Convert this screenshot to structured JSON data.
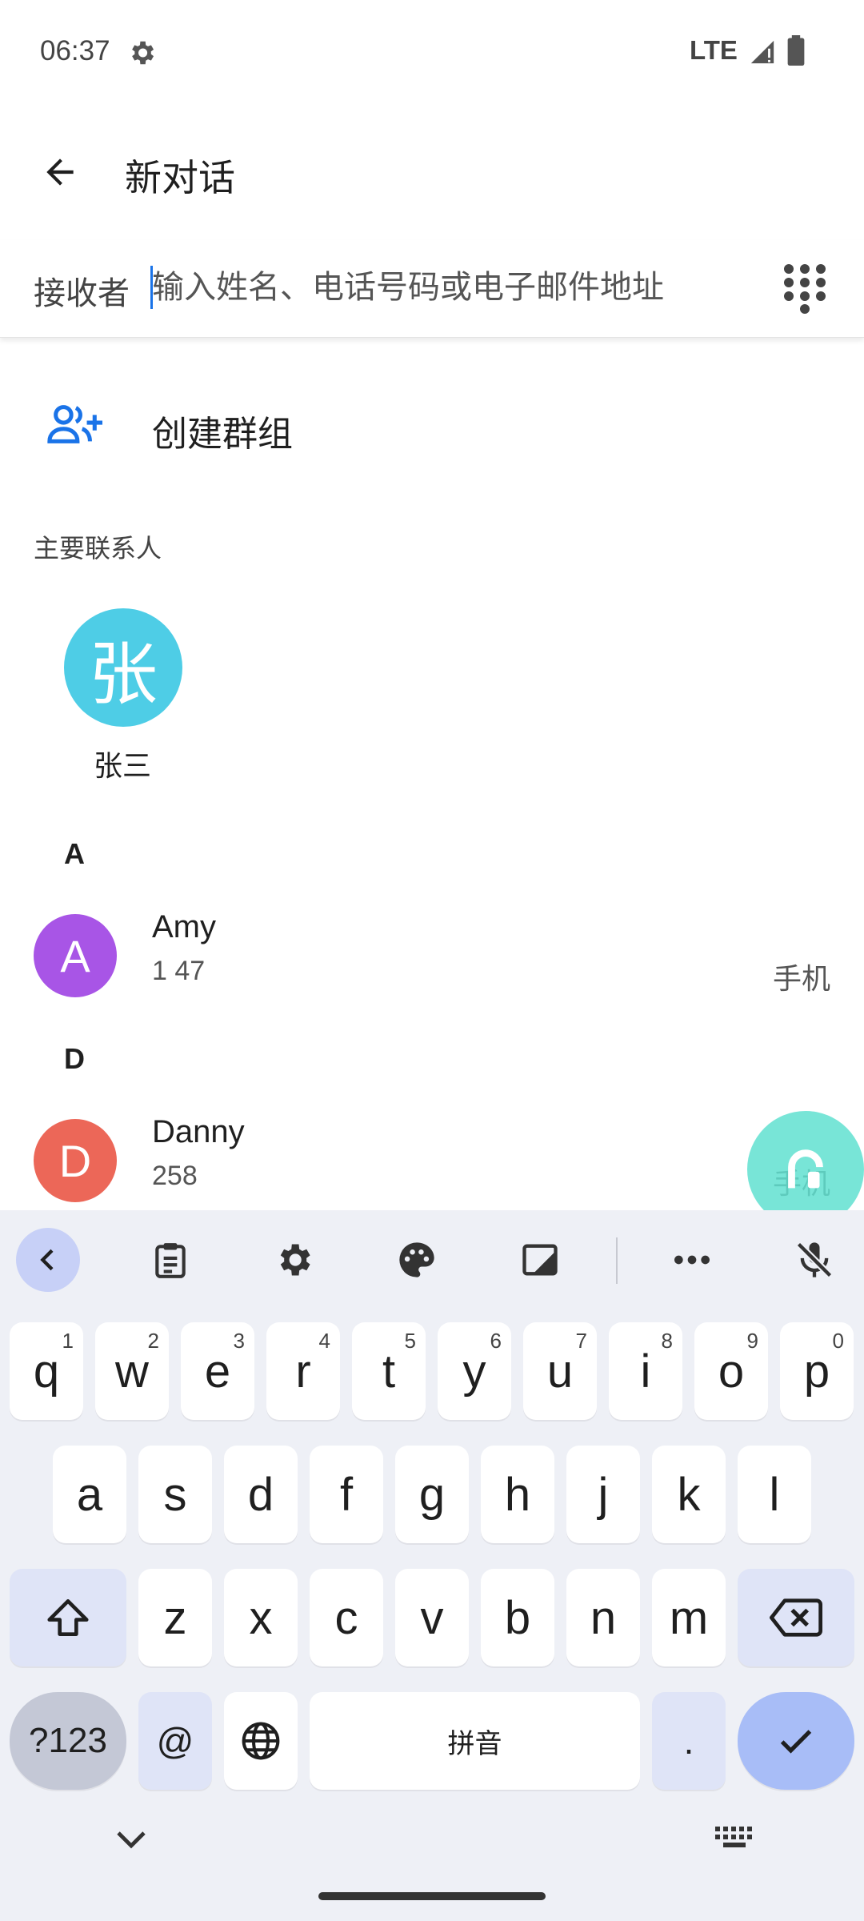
{
  "status_bar": {
    "time": "06:37",
    "network": "LTE",
    "icons": [
      "settings-icon",
      "signal-icon",
      "battery-icon"
    ]
  },
  "app_bar": {
    "title": "新对话",
    "back_icon": "arrow-back-icon"
  },
  "recipient": {
    "label": "接收者",
    "placeholder": "输入姓名、电话号码或电子邮件地址",
    "value": ""
  },
  "create_group": {
    "label": "创建群组",
    "icon": "add-group-icon",
    "color": "#1a73e8"
  },
  "top_contacts": {
    "heading": "主要联系人",
    "items": [
      {
        "name": "张三",
        "initial": "张",
        "color": "#4ecde6"
      }
    ]
  },
  "contacts": [
    {
      "letter": "A",
      "name": "Amy",
      "initial": "A",
      "number": "1 47",
      "type": "手机",
      "color": "#a855e6"
    },
    {
      "letter": "D",
      "name": "Danny",
      "initial": "D",
      "number": "258",
      "type": "手机",
      "color": "#ec6758"
    }
  ],
  "keyboard": {
    "toolbar_icons": [
      "chevron-left-icon",
      "clipboard-icon",
      "settings-icon",
      "palette-icon",
      "crop-icon",
      "more-icon",
      "mic-off-icon"
    ],
    "row1": [
      {
        "key": "q",
        "hint": "1"
      },
      {
        "key": "w",
        "hint": "2"
      },
      {
        "key": "e",
        "hint": "3"
      },
      {
        "key": "r",
        "hint": "4"
      },
      {
        "key": "t",
        "hint": "5"
      },
      {
        "key": "y",
        "hint": "6"
      },
      {
        "key": "u",
        "hint": "7"
      },
      {
        "key": "i",
        "hint": "8"
      },
      {
        "key": "o",
        "hint": "9"
      },
      {
        "key": "p",
        "hint": "0"
      }
    ],
    "row2": [
      "a",
      "s",
      "d",
      "f",
      "g",
      "h",
      "j",
      "k",
      "l"
    ],
    "row3": [
      "z",
      "x",
      "c",
      "v",
      "b",
      "n",
      "m"
    ],
    "symbols_label": "?123",
    "at_label": "@",
    "space_label": "拼音",
    "period_label": "."
  }
}
